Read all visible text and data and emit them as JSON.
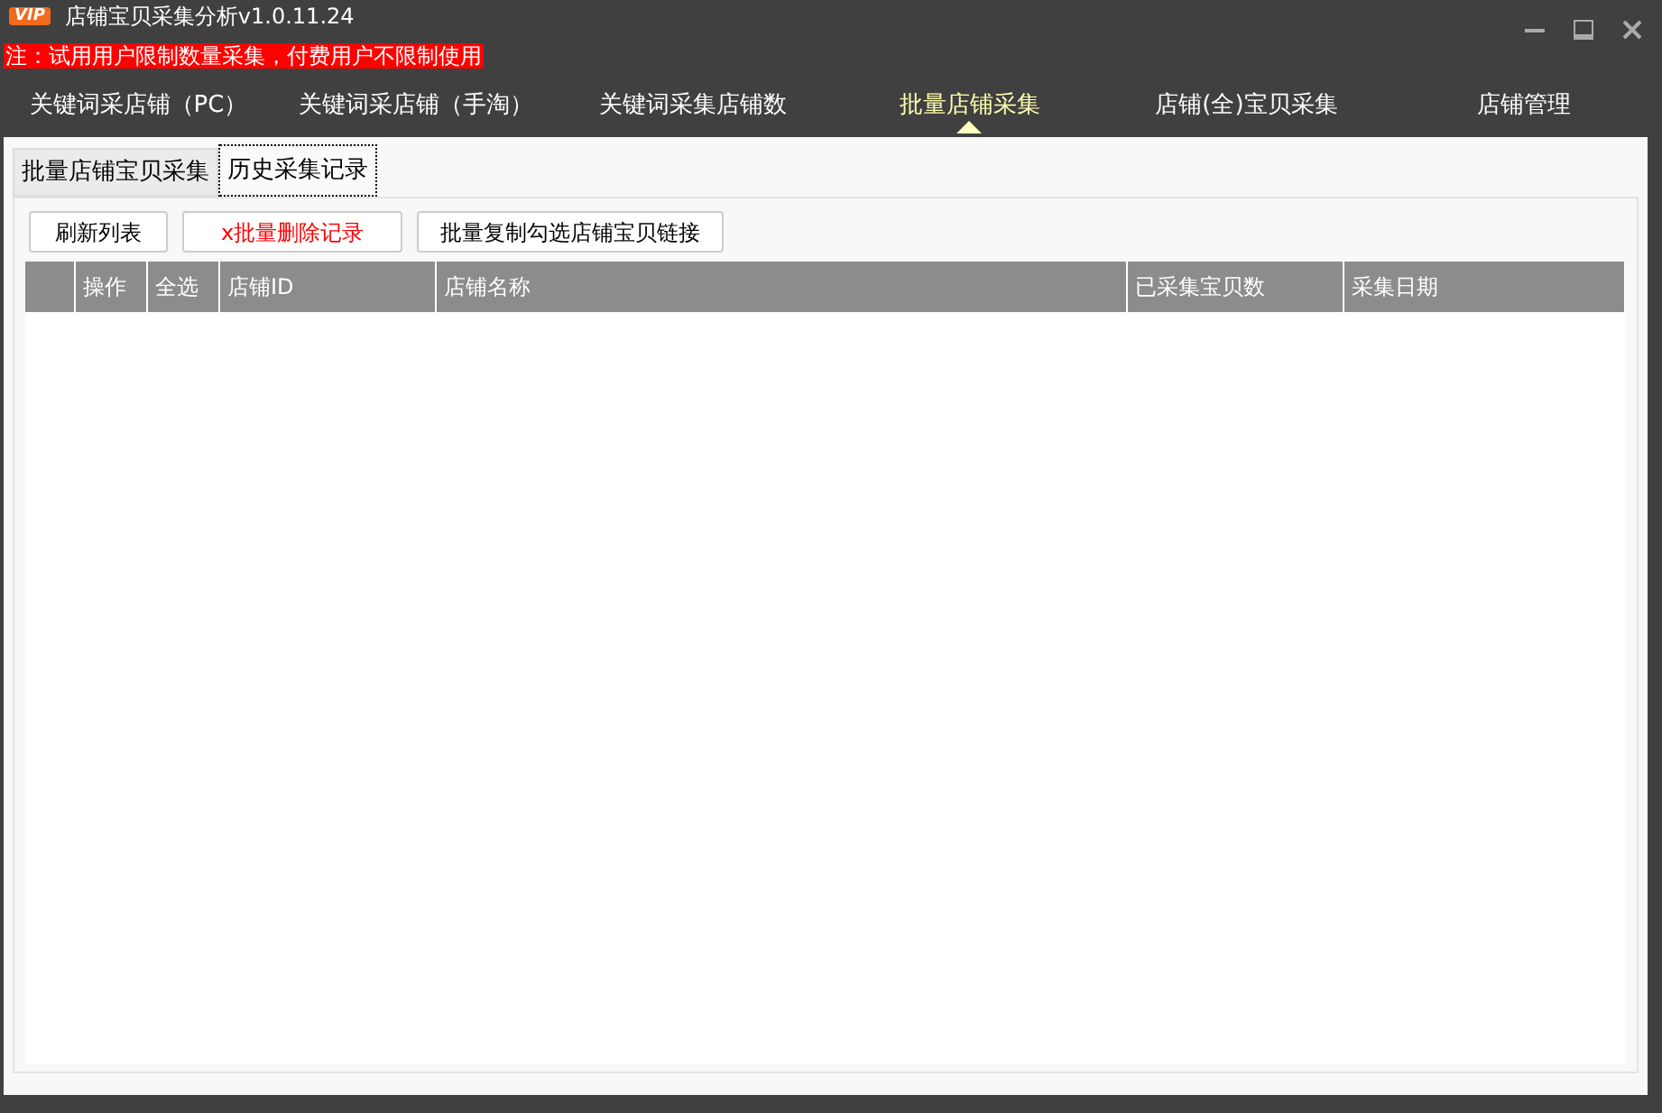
{
  "window": {
    "title": "店铺宝贝采集分析v1.0.11.24",
    "logo": "VIP"
  },
  "notice": "注：试用用户限制数量采集，付费用户不限制使用",
  "nav": [
    {
      "label": "关键词采店铺（PC）",
      "selected": false
    },
    {
      "label": "关键词采店铺（手淘）",
      "selected": false
    },
    {
      "label": "关键词采集店铺数",
      "selected": false
    },
    {
      "label": "批量店铺采集",
      "selected": true
    },
    {
      "label": "店铺(全)宝贝采集",
      "selected": false
    },
    {
      "label": "店铺管理",
      "selected": false
    }
  ],
  "tabs": [
    {
      "label": "批量店铺宝贝采集",
      "selected": false
    },
    {
      "label": "历史采集记录",
      "selected": true
    }
  ],
  "buttons": [
    {
      "label": "刷新列表",
      "kind": "normal"
    },
    {
      "label": "x批量删除记录",
      "kind": "danger"
    },
    {
      "label": "批量复制勾选店铺宝贝链接",
      "kind": "normal"
    }
  ],
  "table": {
    "columns": [
      "操作",
      "全选",
      "店铺ID",
      "店铺名称",
      "已采集宝贝数",
      "采集日期"
    ]
  }
}
